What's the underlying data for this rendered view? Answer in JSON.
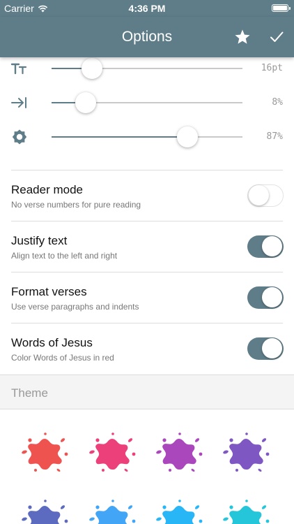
{
  "status_bar": {
    "carrier": "Carrier",
    "time": "4:36 PM",
    "icons": [
      "wifi-icon",
      "battery-icon"
    ]
  },
  "navbar": {
    "title": "Options",
    "actions": [
      "star-icon",
      "checkmark-icon"
    ]
  },
  "sliders": [
    {
      "icon": "text-size-icon",
      "value_text": "16pt",
      "level": 0.21
    },
    {
      "icon": "indent-icon",
      "value_text": "8%",
      "level": 0.18
    },
    {
      "icon": "brightness-icon",
      "value_text": "87%",
      "level": 0.71
    }
  ],
  "toggles": [
    {
      "label": "Reader mode",
      "subtitle": "No verse numbers for pure reading",
      "on": false
    },
    {
      "label": "Justify text",
      "subtitle": "Align text to the left and right",
      "on": true
    },
    {
      "label": "Format verses",
      "subtitle": "Use verse paragraphs and indents",
      "on": true
    },
    {
      "label": "Words of Jesus",
      "subtitle": "Color Words of Jesus in red",
      "on": true
    }
  ],
  "theme": {
    "header": "Theme",
    "swatch_colors": [
      "#ef5350",
      "#ec407a",
      "#ab47bc",
      "#7e57c2",
      "#5c6bc0",
      "#42a5f5",
      "#29b6f6",
      "#26c6da"
    ]
  },
  "colors": {
    "accent": "#5f7d89"
  }
}
